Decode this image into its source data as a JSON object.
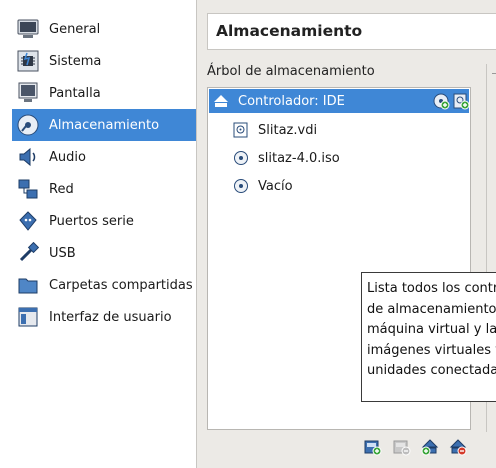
{
  "sidebar": {
    "items": [
      {
        "label": "General",
        "icon": "general-icon"
      },
      {
        "label": "Sistema",
        "icon": "system-chip-icon"
      },
      {
        "label": "Pantalla",
        "icon": "display-monitor-icon"
      },
      {
        "label": "Almacenamiento",
        "icon": "storage-disk-icon",
        "selected": true
      },
      {
        "label": "Audio",
        "icon": "speaker-icon"
      },
      {
        "label": "Red",
        "icon": "network-icon"
      },
      {
        "label": "Puertos serie",
        "icon": "serial-port-icon"
      },
      {
        "label": "USB",
        "icon": "usb-icon"
      },
      {
        "label": "Carpetas compartidas",
        "icon": "shared-folder-icon"
      },
      {
        "label": "Interfaz de usuario",
        "icon": "user-interface-icon"
      }
    ]
  },
  "header": {
    "title": "Almacenamiento"
  },
  "storage_tree": {
    "group_label": "Árbol de almacenamiento",
    "controller": {
      "label": "Controlador: IDE",
      "icon": "ide-controller-icon"
    },
    "attachments": [
      {
        "label": "Slitaz.vdi",
        "icon": "hard-disk-icon"
      },
      {
        "label": "slitaz-4.0.iso",
        "icon": "optical-disc-icon"
      },
      {
        "label": "Vacío",
        "icon": "optical-disc-icon"
      }
    ],
    "controller_buttons": [
      "add-optical-drive-icon",
      "add-hard-disk-icon"
    ]
  },
  "tooltip": {
    "lines": [
      "Lista todos los contr",
      "de almacenamiento p",
      "máquina virtual y las",
      "imágenes virtuales y",
      "unidades conectadas"
    ]
  },
  "bottom_toolbar": [
    "add-controller-icon",
    "remove-controller-icon",
    "add-attachment-icon",
    "remove-attachment-icon"
  ],
  "colors": {
    "selection": "#3f87d6",
    "background": "#eceae6",
    "panel": "#ffffff"
  }
}
